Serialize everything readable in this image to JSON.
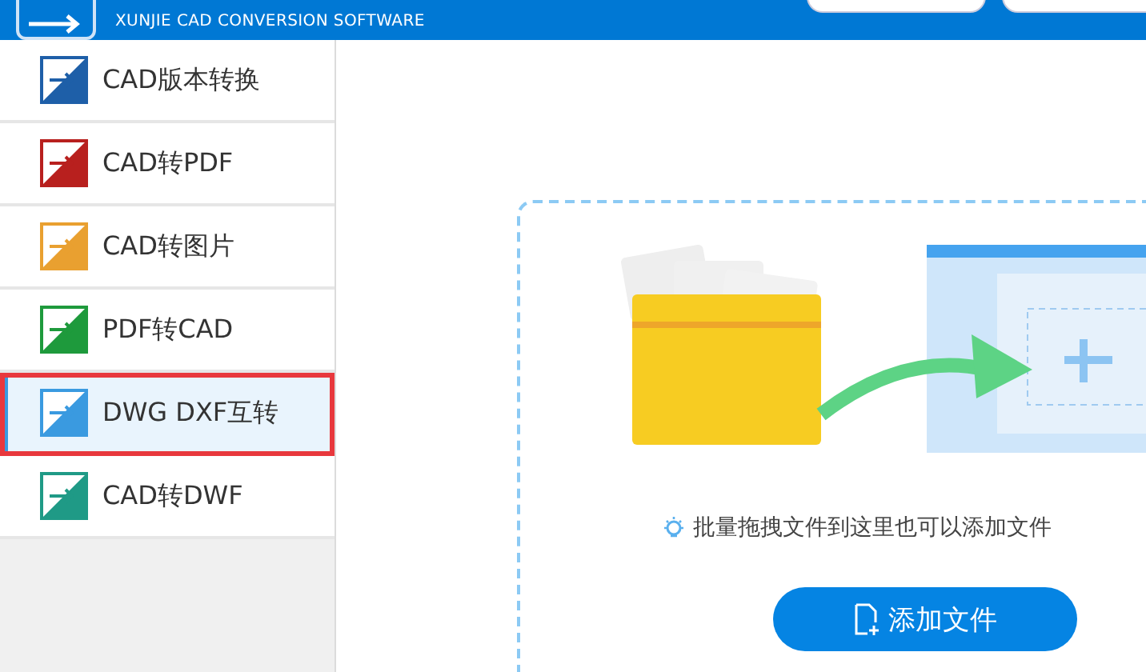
{
  "header": {
    "subtitle": "XUNJIE CAD CONVERSION SOFTWARE"
  },
  "sidebar": {
    "items": [
      {
        "label": "CAD版本转换",
        "color": "#1e5fa8",
        "selected": false
      },
      {
        "label": "CAD转PDF",
        "color": "#b8201e",
        "selected": false
      },
      {
        "label": "CAD转图片",
        "color": "#e9a030",
        "selected": false
      },
      {
        "label": "PDF转CAD",
        "color": "#1e9a3c",
        "selected": false
      },
      {
        "label": "DWG DXF互转",
        "color": "#3a9ae0",
        "selected": true
      },
      {
        "label": "CAD转DWF",
        "color": "#1f9a86",
        "selected": false
      }
    ]
  },
  "dropzone": {
    "hint": "批量拖拽文件到这里也可以添加文件",
    "button": "添加文件"
  }
}
